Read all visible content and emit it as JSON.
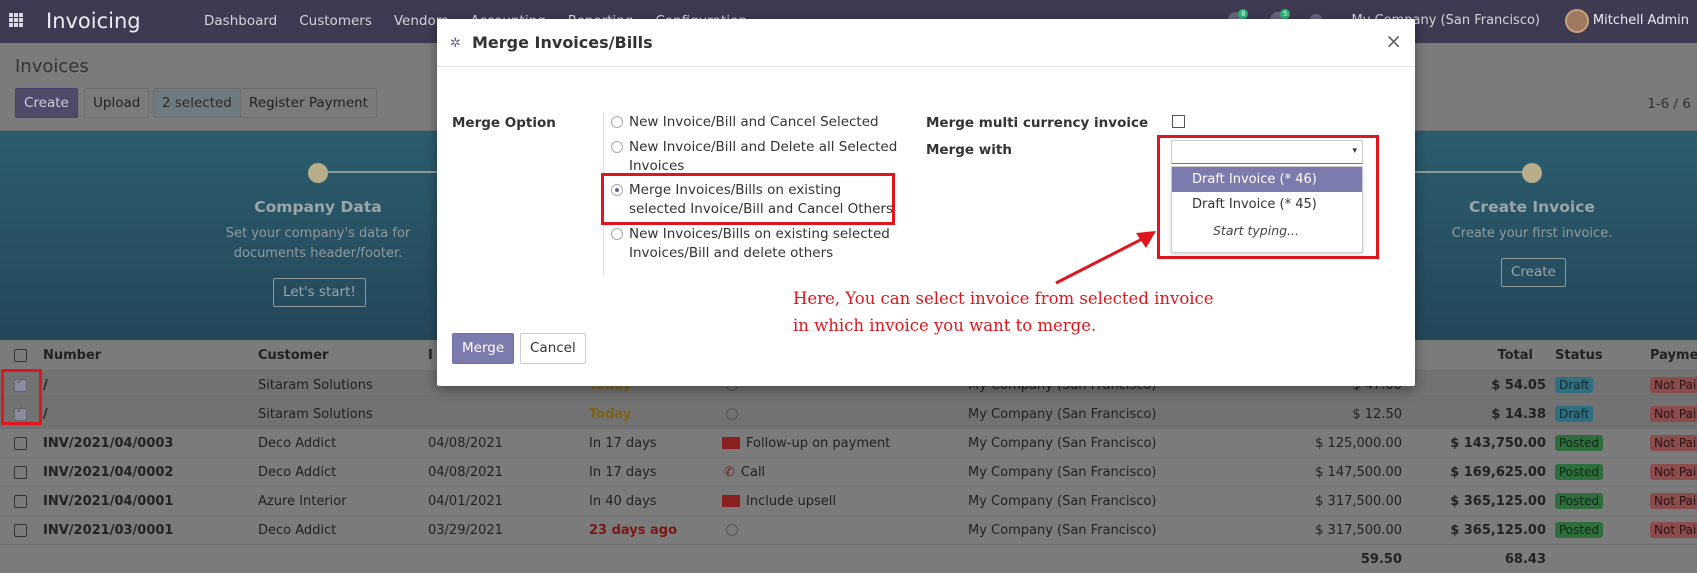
{
  "navbar": {
    "brand": "Invoicing",
    "menu": [
      "Dashboard",
      "Customers",
      "Vendors",
      "Accounting",
      "Reporting",
      "Configuration"
    ],
    "chat_count": "8",
    "activity_count": "5",
    "company": "My Company (San Francisco)",
    "user": "Mitchell Admin"
  },
  "control": {
    "breadcrumb": "Invoices",
    "create": "Create",
    "upload": "Upload",
    "selected": "2 selected",
    "register_payment": "Register Payment",
    "pager": "1-6 / 6"
  },
  "banner": {
    "step1_title": "Company Data",
    "step1_desc": "Set your company's data for documents header/footer.",
    "step1_button": "Let's start!",
    "step2_title": "Create Invoice",
    "step2_desc": "Create your first invoice.",
    "step2_button": "Create"
  },
  "table": {
    "headers": {
      "number": "Number",
      "customer": "Customer",
      "invoice_date": "I",
      "total": "Total",
      "status": "Status",
      "payment": "Payme"
    },
    "rows": [
      {
        "number": "/",
        "customer": "Sitaram Solutions",
        "invoice_date": "",
        "due": "Today",
        "activity": "",
        "company": "My Company (San Francisco)",
        "untaxed": "$ 47.00",
        "total": "$ 54.05",
        "status": "Draft",
        "payment": "Not Pai"
      },
      {
        "number": "/",
        "customer": "Sitaram Solutions",
        "invoice_date": "",
        "due": "Today",
        "activity": "",
        "company": "My Company (San Francisco)",
        "untaxed": "$ 12.50",
        "total": "$ 14.38",
        "status": "Draft",
        "payment": "Not Pai"
      },
      {
        "number": "INV/2021/04/0003",
        "customer": "Deco Addict",
        "invoice_date": "04/08/2021",
        "due": "In 17 days",
        "activity": "Follow-up on payment",
        "company": "My Company (San Francisco)",
        "untaxed": "$ 125,000.00",
        "total": "$ 143,750.00",
        "status": "Posted",
        "payment": "Not Pai"
      },
      {
        "number": "INV/2021/04/0002",
        "customer": "Deco Addict",
        "invoice_date": "04/08/2021",
        "due": "In 17 days",
        "activity": "Call",
        "company": "My Company (San Francisco)",
        "untaxed": "$ 147,500.00",
        "total": "$ 169,625.00",
        "status": "Posted",
        "payment": "Not Pai"
      },
      {
        "number": "INV/2021/04/0001",
        "customer": "Azure Interior",
        "invoice_date": "04/01/2021",
        "due": "In 40 days",
        "activity": "Include upsell",
        "company": "My Company (San Francisco)",
        "untaxed": "$ 317,500.00",
        "total": "$ 365,125.00",
        "status": "Posted",
        "payment": "Not Pai"
      },
      {
        "number": "INV/2021/03/0001",
        "customer": "Deco Addict",
        "invoice_date": "03/29/2021",
        "due": "23 days ago",
        "activity": "",
        "company": "My Company (San Francisco)",
        "untaxed": "$ 317,500.00",
        "total": "$ 365,125.00",
        "status": "Posted",
        "payment": "Not Pai"
      }
    ],
    "footer": {
      "untaxed": "59.50",
      "total": "68.43"
    }
  },
  "modal": {
    "title": "Merge Invoices/Bills",
    "merge_option_label": "Merge Option",
    "options": [
      "New Invoice/Bill and Cancel Selected",
      "New Invoice/Bill and Delete all Selected Invoices",
      "Merge Invoices/Bills on existing selected Invoice/Bill and Cancel Others",
      "New Invoices/Bills on existing selected Invoices/Bill and delete others"
    ],
    "multi_currency_label": "Merge multi currency invoice",
    "merge_with_label": "Merge with",
    "dropdown_items": [
      "Draft Invoice (* 46)",
      "Draft Invoice (* 45)"
    ],
    "dropdown_hint": "Start typing...",
    "merge_button": "Merge",
    "cancel_button": "Cancel"
  },
  "annotation": {
    "note_line1": "Here, You can select invoice from selected invoice",
    "note_line2": "in which invoice you want to merge.",
    "color": "#e0161e"
  }
}
